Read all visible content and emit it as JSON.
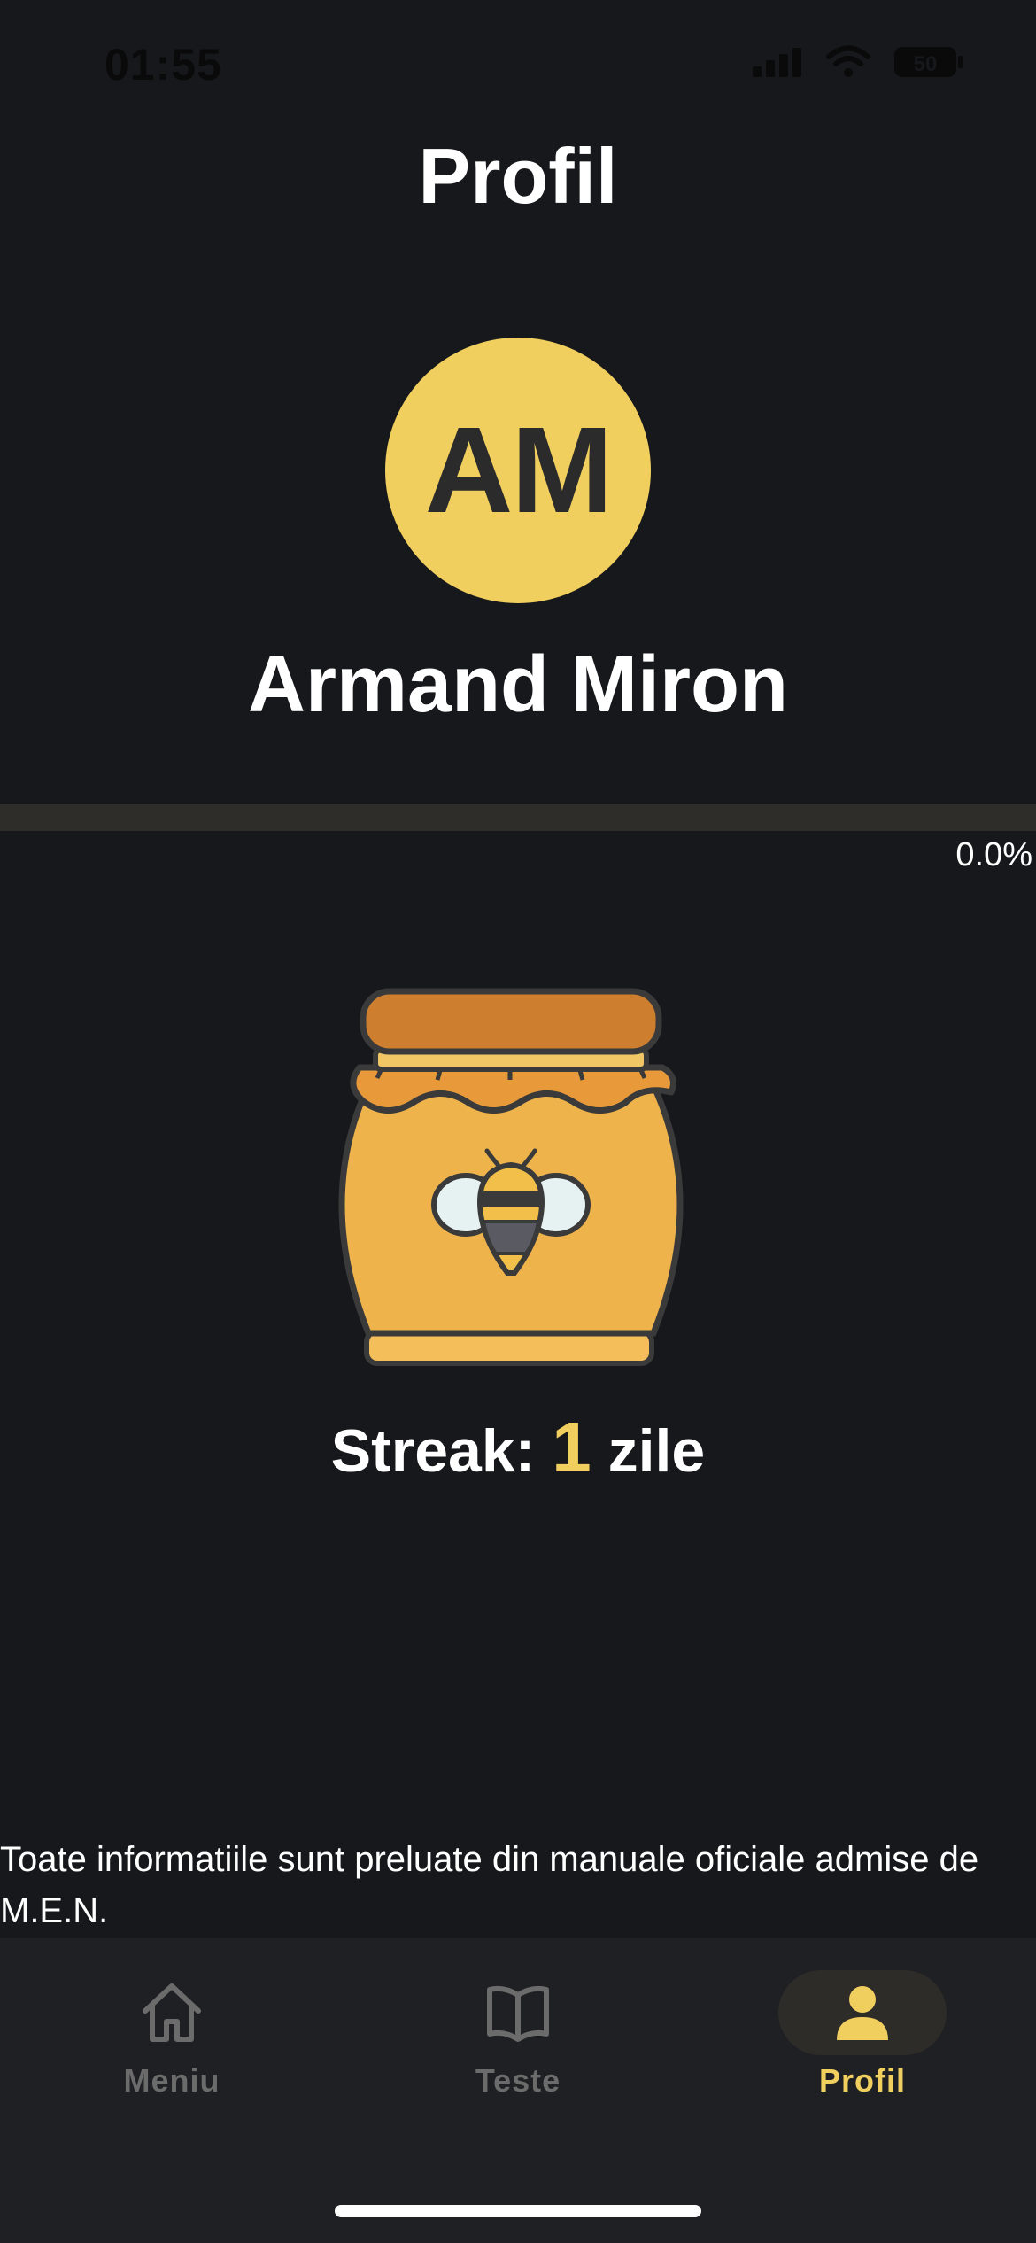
{
  "status_bar": {
    "time": "01:55",
    "battery": "50",
    "icons": [
      "signal-icon",
      "wifi-icon",
      "battery-icon"
    ]
  },
  "header": {
    "title": "Profil"
  },
  "profile": {
    "initials": "AM",
    "name": "Armand Miron",
    "avatar_color": "#f1cf5e",
    "progress_fraction": 0.0,
    "progress_label": "0.0%"
  },
  "streak": {
    "icon": "honey-jar-icon",
    "prefix": "Streak:",
    "count": "1",
    "suffix": "zile"
  },
  "footer": {
    "disclaimer": "Toate informatiile sunt preluate din manuale oficiale admise de M.E.N."
  },
  "tab_bar": {
    "tabs": [
      {
        "label": "Meniu",
        "icon": "home-icon",
        "active": false
      },
      {
        "label": "Teste",
        "icon": "book-icon",
        "active": false
      },
      {
        "label": "Profil",
        "icon": "person-icon",
        "active": true
      }
    ]
  },
  "colors": {
    "background": "#17181c",
    "accent": "#f1cf5e",
    "tab_bar": "#1f2024",
    "inactive": "#6b6b6b"
  }
}
